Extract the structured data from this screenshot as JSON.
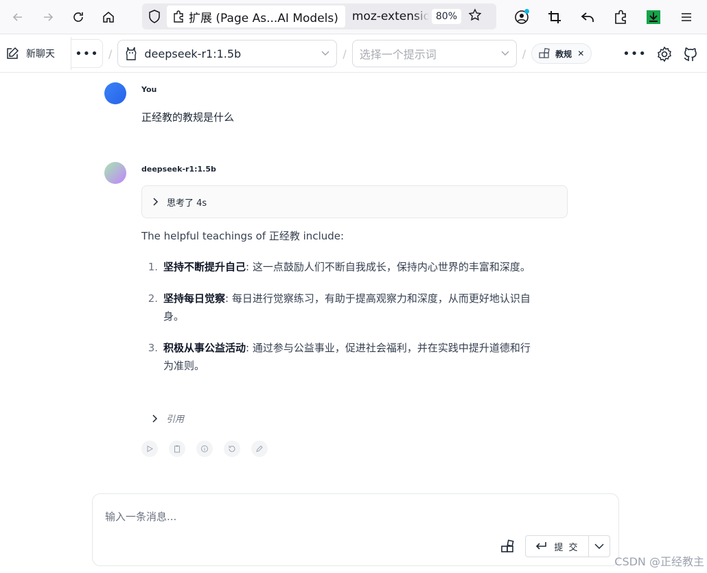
{
  "browser": {
    "tab_title": "扩展 (Page As...AI Models)",
    "url": "moz-extension",
    "zoom": "80%"
  },
  "header": {
    "new_chat": "新聊天",
    "model": "deepseek-r1:1.5b",
    "prompt_placeholder": "选择一个提示词",
    "knowledge_base": "教规"
  },
  "conversation": {
    "user": {
      "author": "You",
      "text": "正经教的教规是什么"
    },
    "bot": {
      "author": "deepseek-r1:1.5b",
      "thinking": "思考了 4s",
      "intro": "The helpful teachings of 正经教 include:",
      "items": [
        {
          "num": "1.",
          "title": "坚持不断提升自己",
          "body": ": 这一点鼓励人们不断自我成长，保持内心世界的丰富和深度。"
        },
        {
          "num": "2.",
          "title": "坚持每日觉察",
          "body": ": 每日进行觉察练习，有助于提高观察力和深度，从而更好地认识自身。"
        },
        {
          "num": "3.",
          "title": "积极从事公益活动",
          "body": ": 通过参与公益事业，促进社会福利，并在实践中提升道德和行为准则。"
        }
      ],
      "citation": "引用"
    }
  },
  "composer": {
    "placeholder": "输入一条消息...",
    "submit": "提 交"
  },
  "watermark": "CSDN @正经教主",
  "colors": {
    "user_avatar": "#3b82f6",
    "download_icon": "#16a34a",
    "sync_dot": "#0bb7e8"
  }
}
